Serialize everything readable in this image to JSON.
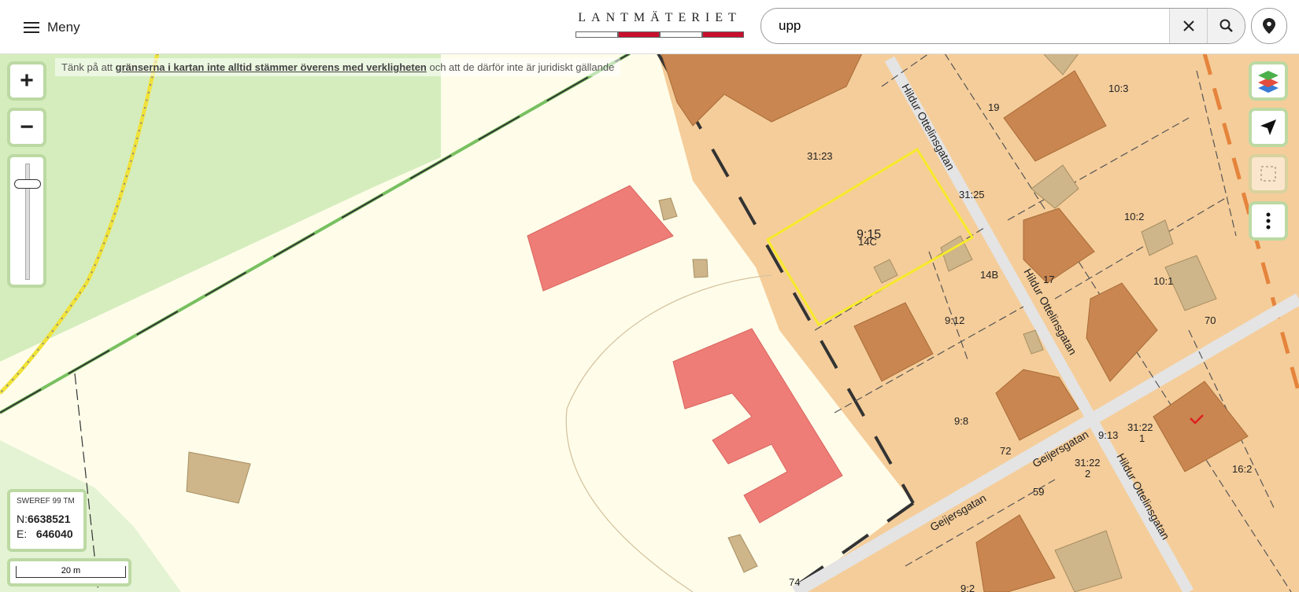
{
  "header": {
    "menu_label": "Meny",
    "logo_text": "LANTMÄTERIET",
    "search": {
      "value": "upp",
      "placeholder": ""
    },
    "icons": {
      "menu": "hamburger-icon",
      "clear": "close-icon",
      "search": "search-icon",
      "location": "location-pin-icon"
    }
  },
  "notice": {
    "prefix": "Tänk på att ",
    "link": "gränserna i kartan inte alltid stämmer överens med verkligheten",
    "suffix": " och att de därför inte är juridiskt gällande"
  },
  "controls": {
    "zoom_in": "+",
    "zoom_out": "−",
    "zoom_level": 0.15,
    "right_icons": [
      "layers-icon",
      "navigation-arrow-icon",
      "select-area-icon",
      "more-vertical-icon"
    ]
  },
  "coordinates": {
    "system": "SWEREF 99 TM",
    "n_label": "N:",
    "n_value": "6638521",
    "e_label": "E:",
    "e_value": "646040"
  },
  "scale": {
    "label": "20 m"
  },
  "map_labels": {
    "parcels": [
      "31:23",
      "9:15",
      "14C",
      "31:25",
      "14B",
      "9:12",
      "9:8",
      "72",
      "19",
      "10:3",
      "10:2",
      "17",
      "10:1",
      "70",
      "9:13",
      "31:22",
      "1",
      "31:22",
      "2",
      "16:2",
      "59",
      "9:2",
      "74"
    ],
    "streets": [
      "Hildur Ottelinsgatan",
      "Hildur Ottelinsgatan",
      "Hildur Ottelinsgatan",
      "Geijersgatan",
      "Geijersgatan"
    ]
  },
  "colors": {
    "accent_border": "#bcd9a3",
    "selected_parcel": "#f7ea2a",
    "building_red": "#ef7d77",
    "building_brown": "#c98650",
    "residential": "#f5cd9a",
    "logo_red": "#c8102e"
  }
}
